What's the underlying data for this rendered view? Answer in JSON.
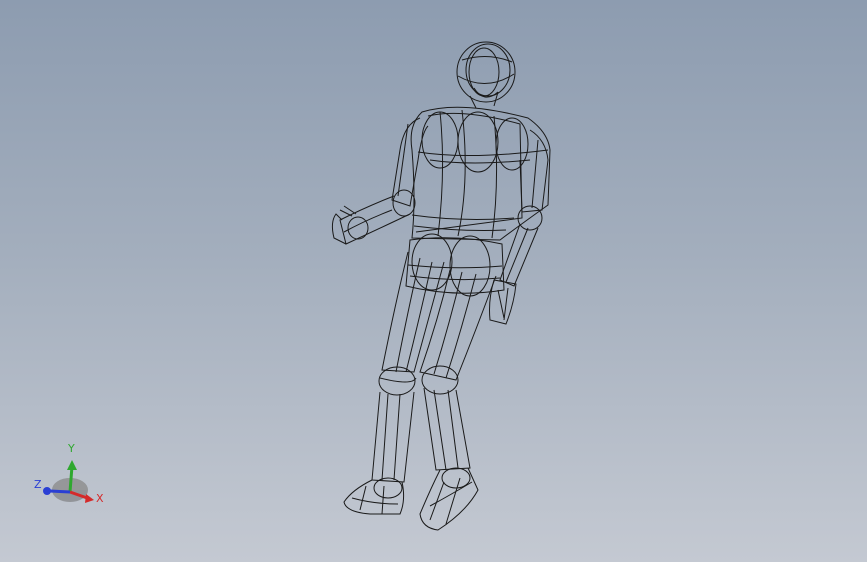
{
  "viewport": {
    "background_top": "#8d9cb0",
    "background_bottom": "#c4c9d2",
    "model_name": "",
    "render_style": "wireframe",
    "line_color": "#1a1a1a"
  },
  "triad": {
    "x_label": "X",
    "y_label": "Y",
    "z_label": "Z",
    "x_color": "#d42a2a",
    "y_color": "#2fa82f",
    "z_color": "#2a3fd4"
  }
}
